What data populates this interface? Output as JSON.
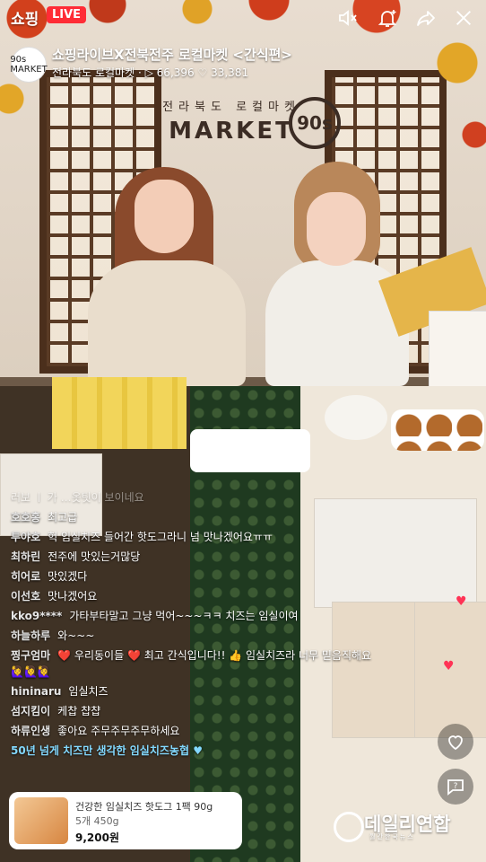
{
  "topbar": {
    "shop_label": "쇼핑",
    "live_label": "LIVE"
  },
  "channel": {
    "avatar_text": "90s MARKET",
    "title": "쇼핑라이브X전북전주 로컬마켓 <간식편>",
    "name": "전라북도 로컬마켓",
    "plays": "66,396",
    "likes": "33,381"
  },
  "scene": {
    "logo_small": "전라북도 로컬마켓",
    "logo_big": "MARKET",
    "logo_badge": "90s"
  },
  "chat": [
    {
      "nick": "",
      "text": "러보 ㅣ 가 …옷팃이 보이네요",
      "faded": true
    },
    {
      "nick": "호호홍",
      "text": "최고급"
    },
    {
      "nick": "투야호",
      "text": "헉 임실치즈 들어간 핫도그라니 넘 맛나겠어요ㅠㅠ"
    },
    {
      "nick": "최하린",
      "text": "전주에 맛있는거많당"
    },
    {
      "nick": "히어로",
      "text": "맛있겠다"
    },
    {
      "nick": "이선호",
      "text": "맛나겠어요"
    },
    {
      "nick": "kko9****",
      "text": "가타부타말고 그냥 먹어~~~ㅋㅋ 치즈는 임실이여"
    },
    {
      "nick": "하늘하루",
      "text": "와~~~"
    },
    {
      "nick": "찡구엄마",
      "text": "❤️ 우리동이들 ❤️ 최고 간식입니다!! 👍 임실치즈라 너무 믿음직해요 🙋‍♀️🙋‍♀️🙋‍♀️"
    },
    {
      "nick": "hininaru",
      "text": "임실치즈"
    },
    {
      "nick": "섬지킴이",
      "text": "케찹 챱챱"
    },
    {
      "nick": "하류인생",
      "text": "좋아요 주무주무주무하세요"
    }
  ],
  "notice": "50년 넘게 치즈만 생각한 임실치즈농협 ♥",
  "product": {
    "title": "건강한 임실치즈 핫도그 1팩 90g",
    "qty": "5개 450g",
    "price": "9,200원"
  },
  "watermark": {
    "main": "데일리연합",
    "sub": "월간한국뉴스"
  },
  "icons": [
    "mute-icon",
    "notification-add-icon",
    "share-icon",
    "close-icon",
    "play-icon",
    "heart-icon",
    "heart-reaction-icon",
    "chat-help-icon"
  ]
}
